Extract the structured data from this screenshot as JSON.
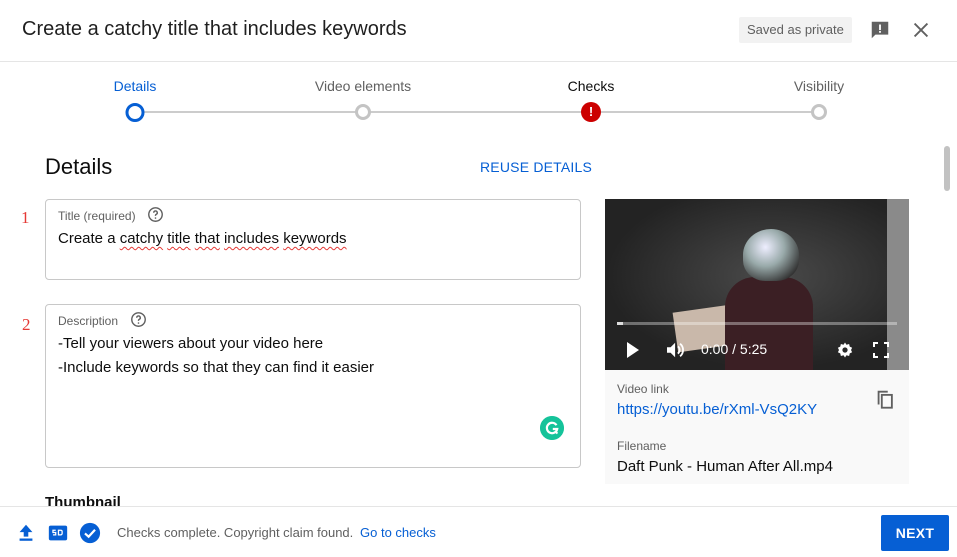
{
  "header": {
    "title": "Create a catchy title that includes keywords",
    "saved_badge": "Saved as private"
  },
  "stepper": {
    "steps": [
      {
        "label": "Details",
        "state": "current"
      },
      {
        "label": "Video elements",
        "state": "pending"
      },
      {
        "label": "Checks",
        "state": "error"
      },
      {
        "label": "Visibility",
        "state": "pending"
      }
    ],
    "error_glyph": "!"
  },
  "details": {
    "section_title": "Details",
    "reuse_label": "REUSE DETAILS",
    "markers": [
      "1",
      "2"
    ],
    "title_field": {
      "label": "Title (required)",
      "value_words": [
        "Create a",
        "catchy",
        "title",
        "that",
        "includes",
        "keywords"
      ]
    },
    "description_field": {
      "label": "Description",
      "lines": [
        "-Tell your viewers about your video here",
        "-Include keywords so that they can find it easier"
      ]
    },
    "thumbnail_label": "Thumbnail"
  },
  "video": {
    "time": "0:00 / 5:25",
    "progress": 0.02,
    "link_label": "Video link",
    "link": "https://youtu.be/rXml-VsQ2KY",
    "filename_label": "Filename",
    "filename": "Daft Punk - Human After All.mp4"
  },
  "footer": {
    "status": "Checks complete. Copyright claim found.",
    "link": "Go to checks",
    "next_label": "NEXT"
  },
  "colors": {
    "accent": "#065fd4",
    "error": "#cc0000",
    "marker": "#e53935",
    "grammarly": "#15c39a"
  },
  "icons": [
    "feedback-icon",
    "close-icon",
    "help-icon",
    "grammarly-icon",
    "play-icon",
    "volume-icon",
    "settings-icon",
    "fullscreen-icon",
    "copy-icon",
    "upload-icon",
    "sd-icon",
    "check-icon"
  ]
}
